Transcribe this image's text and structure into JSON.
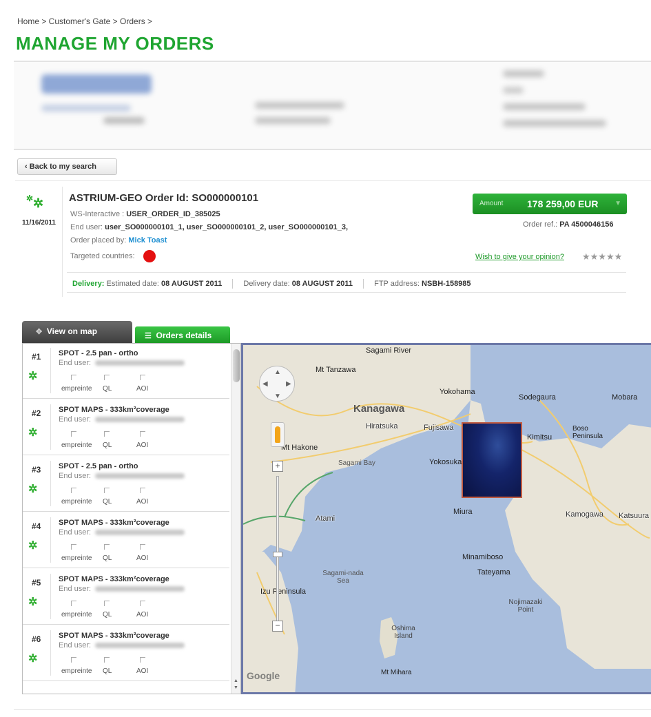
{
  "breadcrumb": "Home > Customer's Gate > Orders >",
  "page_title": "MANAGE MY ORDERS",
  "back_button": "Back to my search",
  "order": {
    "date": "11/16/2011",
    "title": "ASTRIUM-GEO Order Id: SO000000101",
    "ws_label": "WS-Interactive : ",
    "ws_value": "USER_ORDER_ID_385025",
    "end_user_label": "End user: ",
    "end_user_value": "user_SO000000101_1, user_SO000000101_2, user_SO000000101_3,",
    "placed_by_label": "Order placed by: ",
    "placed_by_value": "Mick Toast",
    "countries_label": "Targeted countries:",
    "amount_label": "Amount",
    "amount_value": "178 259,00 EUR",
    "order_ref_label": "Order ref.: ",
    "order_ref_value": "PA 4500046156",
    "opinion_link": "Wish to give your opinion?",
    "stars": "★★★★★",
    "delivery": {
      "label": "Delivery:",
      "estimated_label": "Estimated date: ",
      "estimated_value": "08 AUGUST 2011",
      "delivery_date_label": "Delivery date: ",
      "delivery_date_value": "08 AUGUST 2011",
      "ftp_label": "FTP address: ",
      "ftp_value": "NSBH-158985"
    }
  },
  "tabs": {
    "map": "View on map",
    "details": "Orders details"
  },
  "items": [
    {
      "num": "#1",
      "title": "SPOT - 2.5 pan - ortho",
      "end_user_label": "End user:",
      "checkboxes": [
        "empreinte",
        "QL",
        "AOI"
      ]
    },
    {
      "num": "#2",
      "title": "SPOT MAPS - 333km²coverage",
      "end_user_label": "End user:",
      "checkboxes": [
        "empreinte",
        "QL",
        "AOI"
      ]
    },
    {
      "num": "#3",
      "title": "SPOT - 2.5 pan - ortho",
      "end_user_label": "End user:",
      "checkboxes": [
        "empreinte",
        "QL",
        "AOI"
      ]
    },
    {
      "num": "#4",
      "title": "SPOT MAPS - 333km²coverage",
      "end_user_label": "End user:",
      "checkboxes": [
        "empreinte",
        "QL",
        "AOI"
      ]
    },
    {
      "num": "#5",
      "title": "SPOT MAPS - 333km²coverage",
      "end_user_label": "End user:",
      "checkboxes": [
        "empreinte",
        "QL",
        "AOI"
      ]
    },
    {
      "num": "#6",
      "title": "SPOT MAPS - 333km²coverage",
      "end_user_label": "End user:",
      "checkboxes": [
        "empreinte",
        "QL",
        "AOI"
      ]
    }
  ],
  "map": {
    "labels": {
      "sagami_river": "Sagami River",
      "mt_tanzawa": "Mt Tanzawa",
      "yokohama": "Yokohama",
      "sodegaura": "Sodegaura",
      "mobara": "Mobara",
      "kanagawa": "Kanagawa",
      "hiratsuka": "Hiratsuka",
      "fujisawa": "Fujisawa",
      "kimitsu": "Kimitsu",
      "boso_peninsula": "Boso Peninsula",
      "mt_hakone": "Mt Hakone",
      "sagami_bay": "Sagami Bay",
      "yokosuka": "Yokosuka",
      "miura": "Miura",
      "atami": "Atami",
      "kamogawa": "Kamogawa",
      "katsuura": "Katsuura",
      "minamiboso": "Minamiboso",
      "tateyama": "Tateyama",
      "sagami_nada": "Sagami-nada Sea",
      "izu_peninsula": "Izu Peninsula",
      "nojimazaki": "Nojimazaki Point",
      "oshima": "Oshima Island",
      "mt_mihara": "Mt Mihara",
      "google": "Google"
    }
  },
  "colors": {
    "brand_green": "#1fa531",
    "link_blue": "#1e8fd1",
    "country_dot": "#e41010",
    "map_water": "#a9bedd",
    "map_land": "#e8e4d8"
  }
}
